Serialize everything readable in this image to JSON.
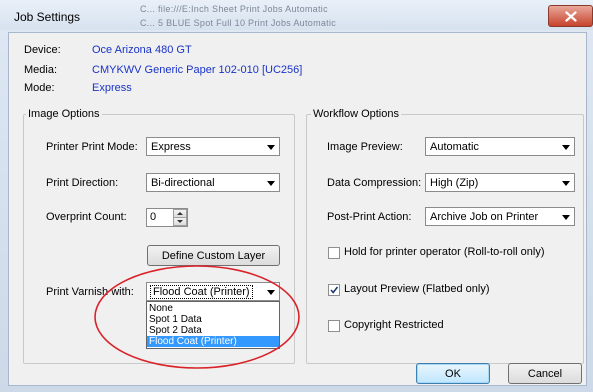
{
  "window": {
    "title": "Job Settings",
    "background_text_1": "C...   file:///E:Inch Sheet         Print Jobs      Automatic",
    "background_text_2": "C...   5 BLUE Spot Full 10         Print Jobs      Automatic"
  },
  "info": {
    "device_label": "Device:",
    "device_value": "Oce Arizona 480 GT",
    "media_label": "Media:",
    "media_value": "CMYKWV Generic Paper 102-010 [UC256]",
    "mode_label": "Mode:",
    "mode_value": "Express"
  },
  "image_options": {
    "title": "Image Options",
    "print_mode_label": "Printer Print Mode:",
    "print_mode_value": "Express",
    "direction_label": "Print Direction:",
    "direction_value": "Bi-directional",
    "overprint_label": "Overprint Count:",
    "overprint_value": "0",
    "define_layer_button": "Define Custom Layer",
    "varnish_label": "Print Varnish with:",
    "varnish_value": "Flood Coat (Printer)",
    "varnish_options": [
      "None",
      "Spot 1 Data",
      "Spot 2 Data",
      "Flood Coat (Printer)"
    ],
    "varnish_selected_index": 3
  },
  "workflow_options": {
    "title": "Workflow Options",
    "image_preview_label": "Image Preview:",
    "image_preview_value": "Automatic",
    "compression_label": "Data Compression:",
    "compression_value": "High (Zip)",
    "post_print_label": "Post-Print Action:",
    "post_print_value": "Archive Job on Printer",
    "hold_label": "Hold for printer operator  (Roll-to-roll only)",
    "hold_checked": false,
    "layout_preview_label": "Layout Preview  (Flatbed only)",
    "layout_preview_checked": true,
    "copyright_label": "Copyright Restricted",
    "copyright_checked": false
  },
  "buttons": {
    "ok": "OK",
    "cancel": "Cancel"
  },
  "colors": {
    "value_blue": "#1a33c7",
    "highlight": "#3399ff",
    "annotation_red": "#d9232a"
  }
}
